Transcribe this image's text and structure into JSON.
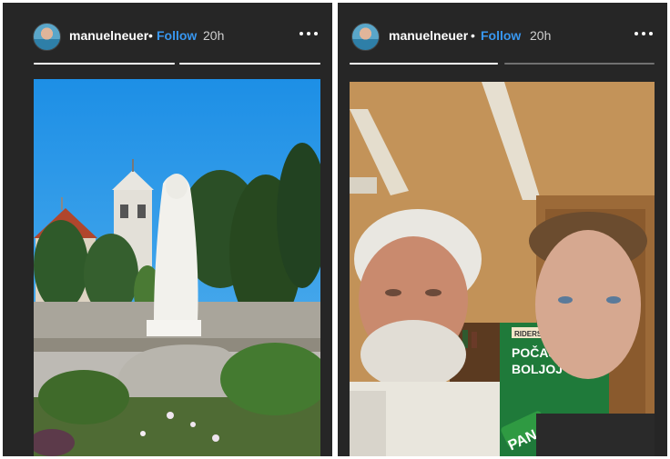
{
  "stories": [
    {
      "username": "manuelneuer",
      "separator": "•",
      "follow_label": "Follow",
      "time": "20h",
      "segments": [
        1,
        1
      ]
    },
    {
      "username": "manuelneuer",
      "separator": "•",
      "follow_label": "Follow",
      "time": "20h",
      "segments": [
        1,
        0
      ]
    }
  ],
  "photo_right": {
    "sign_top": "RIDERS ONLY",
    "sign_main": "POČAST",
    "sign_sub": "BOLJOJ C",
    "brand": "PAN"
  },
  "icons": {
    "more": "more-options-icon",
    "avatar": "avatar"
  }
}
